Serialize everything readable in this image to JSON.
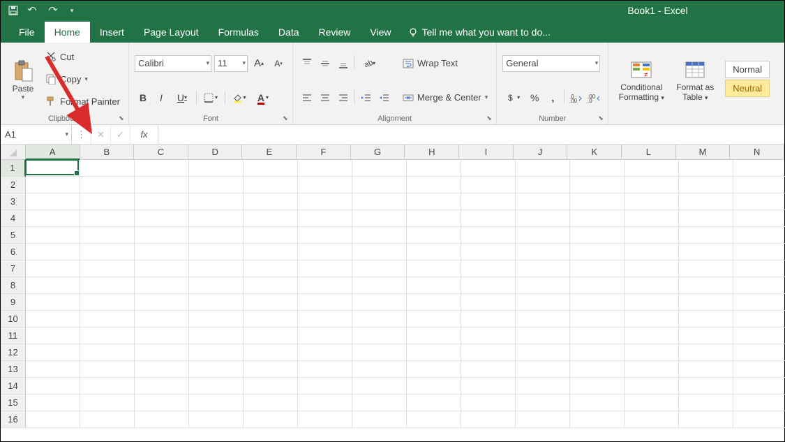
{
  "app": {
    "title": "Book1 - Excel"
  },
  "tabs": [
    "File",
    "Home",
    "Insert",
    "Page Layout",
    "Formulas",
    "Data",
    "Review",
    "View"
  ],
  "active_tab": "Home",
  "tellme": "Tell me what you want to do...",
  "clipboard": {
    "paste": "Paste",
    "cut": "Cut",
    "copy": "Copy",
    "format_painter": "Format Painter",
    "label": "Clipboard"
  },
  "font": {
    "name": "Calibri",
    "size": "11",
    "label": "Font"
  },
  "alignment": {
    "wrap": "Wrap Text",
    "merge": "Merge & Center",
    "label": "Alignment"
  },
  "number": {
    "format": "General",
    "label": "Number"
  },
  "conditional": {
    "line1": "Conditional",
    "line2": "Formatting"
  },
  "format_as": {
    "line1": "Format as",
    "line2": "Table"
  },
  "styles": {
    "normal": "Normal",
    "neutral": "Neutral"
  },
  "namebox": "A1",
  "fx": "fx",
  "columns": [
    "A",
    "B",
    "C",
    "D",
    "E",
    "F",
    "G",
    "H",
    "I",
    "J",
    "K",
    "L",
    "M",
    "N"
  ],
  "rows": [
    "1",
    "2",
    "3",
    "4",
    "5",
    "6",
    "7",
    "8",
    "9",
    "10",
    "11",
    "12",
    "13",
    "14",
    "15",
    "16"
  ],
  "selected_col": "A",
  "selected_row": "1"
}
